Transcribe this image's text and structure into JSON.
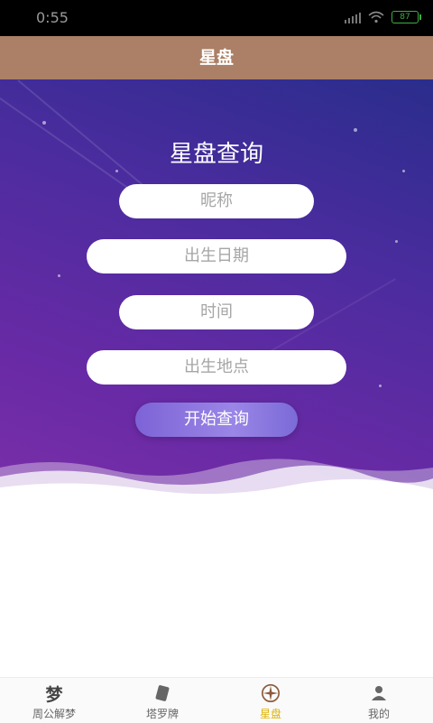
{
  "status_bar": {
    "time": "0:55",
    "battery": "87"
  },
  "app_bar": {
    "title": "星盘"
  },
  "hero": {
    "title": "星盘查询",
    "fields": {
      "nickname_placeholder": "昵称",
      "birth_date_placeholder": "出生日期",
      "time_placeholder": "时间",
      "birth_place_placeholder": "出生地点"
    },
    "start_button": "开始查询"
  },
  "bottom_nav": {
    "items": [
      {
        "label": "周公解梦",
        "icon": "dream-icon",
        "glyph": "梦"
      },
      {
        "label": "塔罗牌",
        "icon": "tarot-card-icon"
      },
      {
        "label": "星盘",
        "icon": "compass-icon",
        "active": true
      },
      {
        "label": "我的",
        "icon": "person-icon"
      }
    ],
    "active_color": "#e0b300"
  },
  "colors": {
    "app_bar": "#ab8067",
    "hero_top": "#2a2d8c",
    "hero_bottom": "#7a2fa8"
  }
}
